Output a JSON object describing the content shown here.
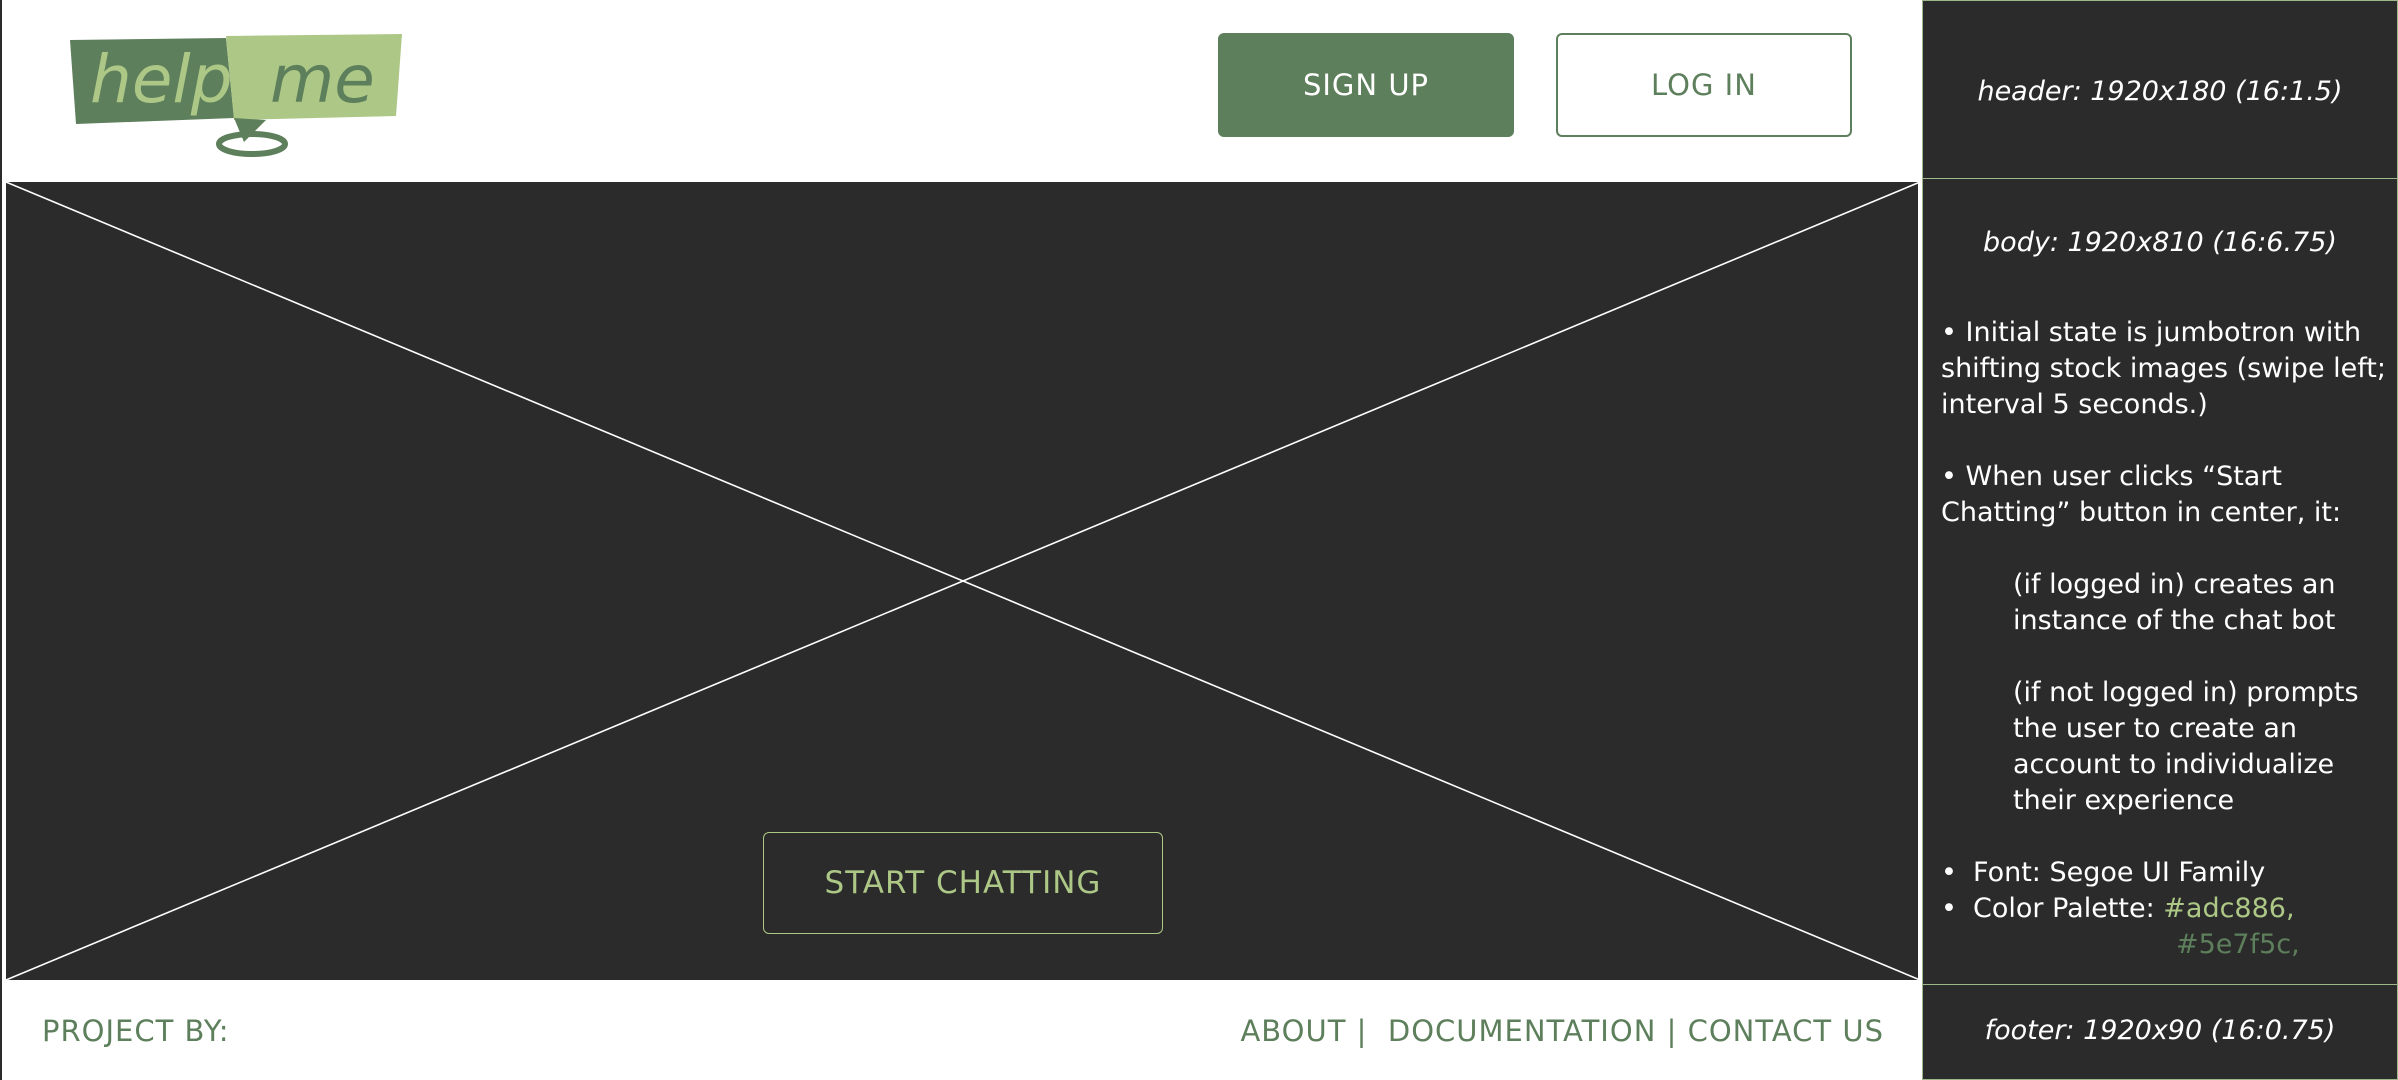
{
  "header": {
    "logo": {
      "part1": "help",
      "part2": "me"
    },
    "signup_label": "SIGN UP",
    "login_label": "LOG IN"
  },
  "hero": {
    "start_label": "START CHATTING"
  },
  "footer": {
    "project_by": "PROJECT BY:",
    "links": [
      "ABOUT",
      "DOCUMENTATION",
      "CONTACT US"
    ]
  },
  "notes": {
    "header_spec": "header: 1920x180 (16:1.5)",
    "body_spec": "body: 1920x810 (16:6.75)",
    "body_lines": [
      "• Initial state is jumbotron with shifting stock images (swipe left; interval 5 seconds.)",
      "• When user clicks “Start Chatting” button in center, it:",
      "(if logged in) creates an instance of the chat bot",
      "(if not logged in) prompts the user to create an account to individualize their experience"
    ],
    "font_line": "Font: Segoe UI Family",
    "palette_label": "Color Palette:",
    "palette": [
      "#adc886,",
      "#5e7f5c,"
    ],
    "footer_spec": "footer: 1920x90 (16:0.75)"
  },
  "colors": {
    "accent_light": "#adc886",
    "accent_dark": "#5e7f5c",
    "panel_bg": "#2b2b2b"
  }
}
